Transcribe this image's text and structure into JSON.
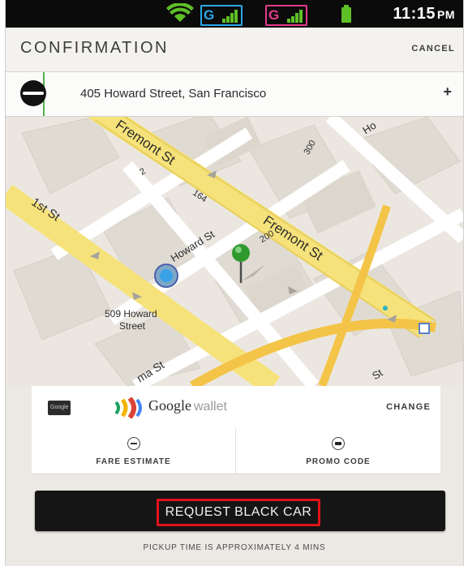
{
  "status_bar": {
    "time": "11:15",
    "ampm": "PM",
    "network1": "G",
    "network2": "G",
    "icons": [
      "wifi-icon",
      "signal-icon",
      "signal-icon",
      "battery-icon"
    ],
    "colors": {
      "network1": "#2aa7e8",
      "network2": "#e53b8d",
      "battery": "#5fbf27"
    }
  },
  "header": {
    "title": "CONFIRMATION",
    "cancel_label": "CANCEL"
  },
  "address": {
    "text": "405 Howard Street, San Francisco",
    "add_label": "+",
    "icon": "car-icon"
  },
  "map": {
    "labels": {
      "fremont_upper": "Fremont St",
      "fremont_lower": "Fremont St",
      "first_st": "1st St",
      "howard": "Howard St",
      "place_line1": "509 Howard",
      "place_line2": "Street",
      "num_2": "2",
      "num_164": "164",
      "num_200": "200",
      "num_300": "300",
      "hc": "Ho",
      "natoma": "ma St",
      "st_bottom": "St"
    }
  },
  "payment": {
    "card_text": "Google",
    "provider": "Google",
    "provider_suffix": "wallet",
    "change_label": "CHANGE"
  },
  "options": {
    "fare_label": "FARE ESTIMATE",
    "promo_label": "PROMO CODE"
  },
  "request": {
    "label": "REQUEST BLACK CAR",
    "highlight_color": "#e2121b"
  },
  "footer": {
    "pickup_text": "PICKUP TIME IS APPROXIMATELY 4 MINS"
  }
}
